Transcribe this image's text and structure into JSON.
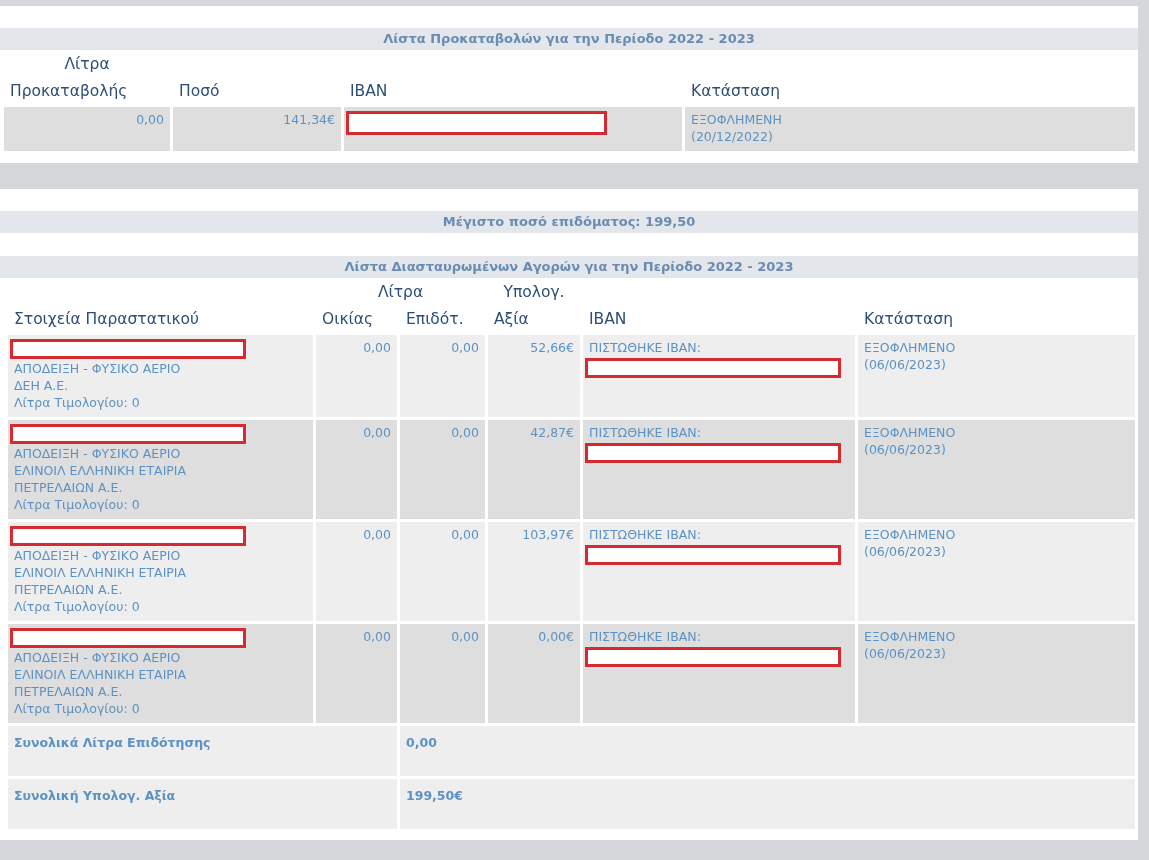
{
  "advances": {
    "title": "Λίστα Προκαταβολών για την Περίοδο 2022 - 2023",
    "columns": [
      {
        "label": "Προκαταβολής",
        "group": "Λίτρα"
      },
      {
        "label": "Ποσό"
      },
      {
        "label": "IBAN"
      },
      {
        "label": "Κατάσταση"
      }
    ],
    "rows": [
      {
        "cells": [
          [
            {
              "kind": "number",
              "text": "0,00"
            }
          ],
          [
            {
              "kind": "number",
              "text": "141,34€"
            }
          ],
          [
            {
              "kind": "redaction"
            }
          ],
          [
            {
              "kind": "status",
              "lines": [
                "ΕΞΟΦΛΗΜΕΝΗ",
                "(20/12/2022)"
              ]
            }
          ]
        ]
      }
    ]
  },
  "max_amount": "Μέγιστο ποσό επιδόματος: 199,50",
  "purchases": {
    "title": "Λίστα Διασταυρωμένων Αγορών για την Περίοδο 2022 - 2023",
    "columns": [
      {
        "label": "Στοιχεία Παραστατικού"
      },
      {
        "label": "Οικίας",
        "group": "Λίτρα"
      },
      {
        "label": "Επιδότ.",
        "in_group": true
      },
      {
        "label": "Αξία",
        "group": "Υπολογ."
      },
      {
        "label": "IBAN"
      },
      {
        "label": "Κατάσταση"
      }
    ],
    "rows": [
      {
        "cells": [
          [
            {
              "kind": "redaction"
            },
            {
              "kind": "description",
              "lines": [
                "ΑΠΟΔΕΙΞΗ - ΦΥΣΙΚΟ ΑΕΡΙΟ",
                "ΔΕΗ Α.Ε."
              ]
            },
            {
              "kind": "text",
              "text": "Λίτρα Τιμολογίου: 0"
            }
          ],
          [
            {
              "kind": "number",
              "text": "0,00"
            }
          ],
          [
            {
              "kind": "number",
              "text": "0,00"
            }
          ],
          [
            {
              "kind": "number",
              "text": "52,66€"
            }
          ],
          [
            {
              "kind": "text",
              "text": "ΠΙΣΤΩΘΗΚΕ ΙΒΑΝ:"
            },
            {
              "kind": "redaction"
            }
          ],
          [
            {
              "kind": "status",
              "lines": [
                "ΕΞΟΦΛΗΜΕΝΟ",
                "(06/06/2023)"
              ]
            }
          ]
        ]
      },
      {
        "cells": [
          [
            {
              "kind": "redaction"
            },
            {
              "kind": "description",
              "lines": [
                "ΑΠΟΔΕΙΞΗ - ΦΥΣΙΚΟ ΑΕΡΙΟ",
                "ΕΛΙΝΟΙΛ ΕΛΛΗΝΙΚΗ ΕΤΑΙΡΙΑ",
                "ΠΕΤΡΕΛΑΙΩΝ Α.Ε."
              ]
            },
            {
              "kind": "text",
              "text": "Λίτρα Τιμολογίου: 0"
            }
          ],
          [
            {
              "kind": "number",
              "text": "0,00"
            }
          ],
          [
            {
              "kind": "number",
              "text": "0,00"
            }
          ],
          [
            {
              "kind": "number",
              "text": "42,87€"
            }
          ],
          [
            {
              "kind": "text",
              "text": "ΠΙΣΤΩΘΗΚΕ ΙΒΑΝ:"
            },
            {
              "kind": "redaction"
            }
          ],
          [
            {
              "kind": "status",
              "lines": [
                "ΕΞΟΦΛΗΜΕΝΟ",
                "(06/06/2023)"
              ]
            }
          ]
        ]
      },
      {
        "cells": [
          [
            {
              "kind": "redaction"
            },
            {
              "kind": "description",
              "lines": [
                "ΑΠΟΔΕΙΞΗ - ΦΥΣΙΚΟ ΑΕΡΙΟ",
                "ΕΛΙΝΟΙΛ ΕΛΛΗΝΙΚΗ ΕΤΑΙΡΙΑ",
                "ΠΕΤΡΕΛΑΙΩΝ Α.Ε."
              ]
            },
            {
              "kind": "text",
              "text": "Λίτρα Τιμολογίου: 0"
            }
          ],
          [
            {
              "kind": "number",
              "text": "0,00"
            }
          ],
          [
            {
              "kind": "number",
              "text": "0,00"
            }
          ],
          [
            {
              "kind": "number",
              "text": "103,97€"
            }
          ],
          [
            {
              "kind": "text",
              "text": "ΠΙΣΤΩΘΗΚΕ ΙΒΑΝ:"
            },
            {
              "kind": "redaction"
            }
          ],
          [
            {
              "kind": "status",
              "lines": [
                "ΕΞΟΦΛΗΜΕΝΟ",
                "(06/06/2023)"
              ]
            }
          ]
        ]
      },
      {
        "cells": [
          [
            {
              "kind": "redaction"
            },
            {
              "kind": "description",
              "lines": [
                "ΑΠΟΔΕΙΞΗ - ΦΥΣΙΚΟ ΑΕΡΙΟ",
                "ΕΛΙΝΟΙΛ ΕΛΛΗΝΙΚΗ ΕΤΑΙΡΙΑ",
                "ΠΕΤΡΕΛΑΙΩΝ Α.Ε."
              ]
            },
            {
              "kind": "text",
              "text": "Λίτρα Τιμολογίου: 0"
            }
          ],
          [
            {
              "kind": "number",
              "text": "0,00"
            }
          ],
          [
            {
              "kind": "number",
              "text": "0,00"
            }
          ],
          [
            {
              "kind": "number",
              "text": "0,00€"
            }
          ],
          [
            {
              "kind": "text",
              "text": "ΠΙΣΤΩΘΗΚΕ ΙΒΑΝ:"
            },
            {
              "kind": "redaction"
            }
          ],
          [
            {
              "kind": "status",
              "lines": [
                "ΕΞΟΦΛΗΜΕΝΟ",
                "(06/06/2023)"
              ]
            }
          ]
        ]
      }
    ],
    "totals": [
      {
        "label": "Συνολικά Λίτρα Επιδότησης",
        "value": "0,00"
      },
      {
        "label": "Συνολική Υπολογ. Αξία",
        "value": "199,50€"
      }
    ]
  }
}
